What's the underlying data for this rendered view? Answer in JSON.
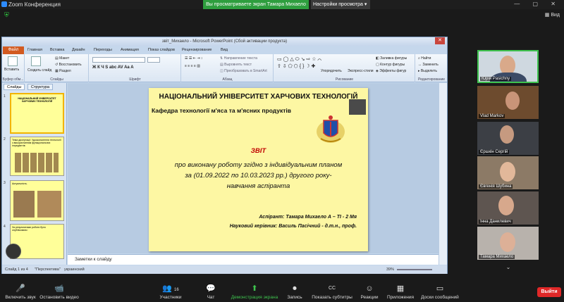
{
  "zoom": {
    "window_title": "Zoom Конференция",
    "share_banner": "Вы просматриваете экран Тамара Михаело",
    "view_options": "Настройки просмотра",
    "view_button": "Вид",
    "leave_label": "Выйти",
    "participants_count": "16",
    "toolbar": [
      {
        "name": "mute",
        "label": "Включить звук",
        "icon": "🎤"
      },
      {
        "name": "video",
        "label": "Остановить видео",
        "icon": "📹"
      },
      {
        "name": "participants",
        "label": "Участники",
        "icon": "👥"
      },
      {
        "name": "chat",
        "label": "Чат",
        "icon": "💬"
      },
      {
        "name": "share",
        "label": "Демонстрация экрана",
        "icon": "⬆"
      },
      {
        "name": "record",
        "label": "Запись",
        "icon": "⏺"
      },
      {
        "name": "captions",
        "label": "Показать субтитры",
        "icon": "CC"
      },
      {
        "name": "reactions",
        "label": "Реакции",
        "icon": "☺"
      },
      {
        "name": "apps",
        "label": "Приложения",
        "icon": "▦"
      },
      {
        "name": "whiteboard",
        "label": "Доски сообщений",
        "icon": "▭"
      }
    ],
    "participants": [
      {
        "name": "Юрій Pasichny"
      },
      {
        "name": "Vlad Markov"
      },
      {
        "name": "Єршкін Сергій"
      },
      {
        "name": "Євгенія Шубина"
      },
      {
        "name": "Інна Данилевич"
      },
      {
        "name": "Тамара Михаело"
      }
    ]
  },
  "ppt": {
    "title": "звіт_Михаело - Microsoft PowerPoint (Сбой активации продукта)",
    "file_tab": "Файл",
    "tabs": [
      "Главная",
      "Вставка",
      "Дизайн",
      "Переходы",
      "Анимация",
      "Показ слайдов",
      "Рецензирование",
      "Вид"
    ],
    "ribbon": {
      "paste": "Вставить",
      "new_slide": "Создать слайд",
      "layout": "Макет",
      "reset": "Восстановить",
      "section": "Раздел",
      "clipboard": "Буфер обм...",
      "slides": "Слайды",
      "font": "Шрифт",
      "paragraph": "Абзац",
      "text_direction": "Направление текста",
      "align_text": "Выровнять текст",
      "smartart": "Преобразовать в SmartArt",
      "drawing": "Рисование",
      "arrange": "Упорядочить",
      "quick_styles": "Экспресс-стили",
      "shape_fill": "Заливка фигуры",
      "shape_outline": "Контур фигуры",
      "shape_effects": "Эффекты фигур",
      "find": "Найти",
      "replace": "Заменить",
      "select": "Выделить",
      "editing": "Редактирование"
    },
    "side_tabs": [
      "Слайды",
      "Структура"
    ],
    "notes_placeholder": "Заметки к слайду",
    "status": {
      "slide": "Слайд 1 из 4",
      "theme": "\"Перспектива\"",
      "lang": "украинский",
      "zoom": "39%"
    },
    "thumb_texts": [
      "НАЦІОНАЛЬНИЙ УНІВЕРСИТЕТ ХАРЧОВИХ ТЕХНОЛОГІЙ",
      "Тема дисертації: Удосконалення технології з використанням функціональних інгредієнтів",
      "Актуальність.",
      "За результатами роботи було опубліковано:"
    ]
  },
  "slide": {
    "university": "НАЦІОНАЛЬНИЙ УНІВЕРСИТЕТ ХАРЧОВИХ ТЕХНОЛОГІЙ",
    "department": "Кафедра технології м'яса та м'ясних продуктів",
    "report_title": "ЗВІТ",
    "line1": "про виконану роботу згідно з індивідуальним планом",
    "line2": "за (01.09.2022 по 10.03.2023 рр.) другого року-",
    "line3": "навчання аспіранта",
    "aspirant": "Аспірант: Тамара Михаело А – ТІ - 2 Мя",
    "supervisor": "Науковий керівник: Василь Пасічний - д.т.н., проф."
  }
}
